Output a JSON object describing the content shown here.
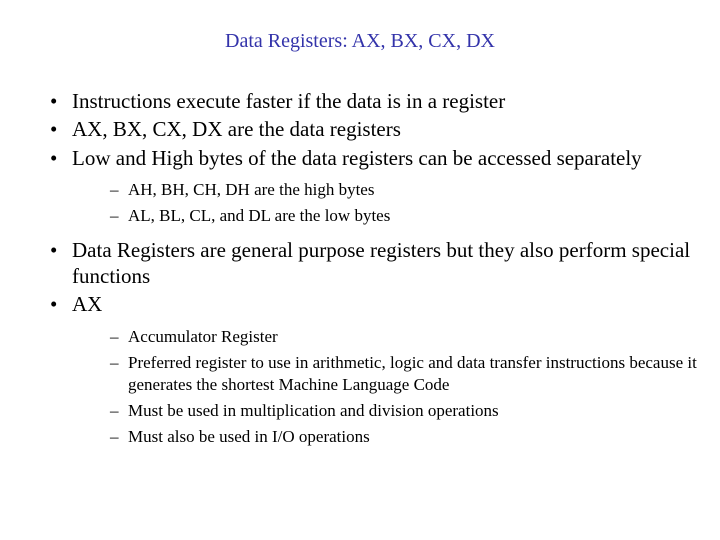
{
  "title": "Data Registers: AX, BX, CX, DX",
  "bullets": {
    "b1": "Instructions execute faster if the data is in a register",
    "b2": "AX, BX, CX, DX  are the data registers",
    "b3": "Low and High bytes of the data registers can be accessed separately",
    "b3_sub": {
      "s1": "AH, BH, CH, DH are the high bytes",
      "s2": "AL, BL, CL, and DL are the low bytes"
    },
    "b4": "Data Registers are general purpose registers but they also perform special functions",
    "b5": "AX",
    "b5_sub": {
      "s1": "Accumulator Register",
      "s2": "Preferred register to use in arithmetic, logic and data transfer instructions because it generates the shortest Machine Language Code",
      "s3": "Must be used in multiplication and division operations",
      "s4": "Must also be used in I/O operations"
    }
  }
}
